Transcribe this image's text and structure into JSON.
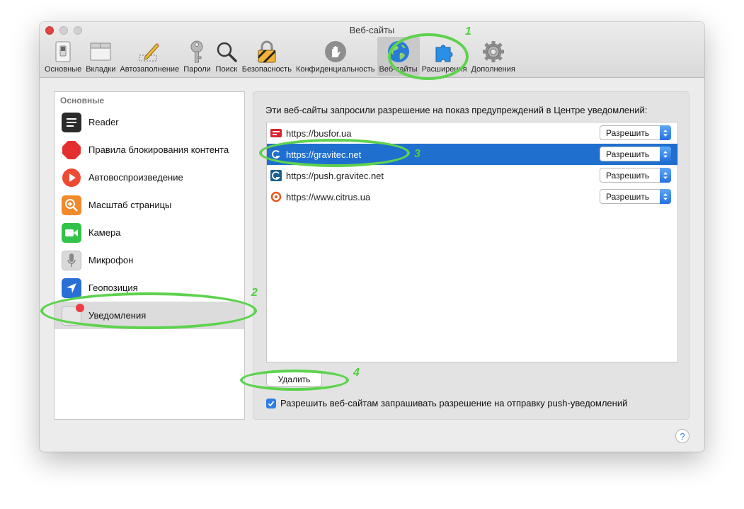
{
  "window": {
    "title": "Веб-сайты"
  },
  "toolbar": {
    "items": [
      {
        "label": "Основные",
        "icon": "general-switch-icon"
      },
      {
        "label": "Вкладки",
        "icon": "tabs-icon"
      },
      {
        "label": "Автозаполнение",
        "icon": "pencil-icon"
      },
      {
        "label": "Пароли",
        "icon": "key-icon"
      },
      {
        "label": "Поиск",
        "icon": "magnifier-icon"
      },
      {
        "label": "Безопасность",
        "icon": "padlock-icon"
      },
      {
        "label": "Конфиденциальность",
        "icon": "hand-icon"
      },
      {
        "label": "Веб-сайты",
        "icon": "globe-icon",
        "active": true
      },
      {
        "label": "Расширения",
        "icon": "puzzle-icon"
      },
      {
        "label": "Дополнения",
        "icon": "gear-icon"
      }
    ]
  },
  "sidebar": {
    "header": "Основные",
    "items": [
      {
        "label": "Reader",
        "icon": "reader-icon"
      },
      {
        "label": "Правила блокирования контента",
        "icon": "stop-icon"
      },
      {
        "label": "Автовоспроизведение",
        "icon": "play-icon"
      },
      {
        "label": "Масштаб страницы",
        "icon": "zoom-icon"
      },
      {
        "label": "Камера",
        "icon": "camera-icon"
      },
      {
        "label": "Микрофон",
        "icon": "microphone-icon"
      },
      {
        "label": "Геопозиция",
        "icon": "location-arrow-icon"
      },
      {
        "label": "Уведомления",
        "icon": "notifications-icon",
        "selected": true
      }
    ]
  },
  "content": {
    "description": "Эти веб-сайты запросили разрешение на показ предупреждений в Центре уведомлений:",
    "sites": [
      {
        "url": "https://busfor.ua",
        "permission": "Разрешить"
      },
      {
        "url": "https://gravitec.net",
        "permission": "Разрешить",
        "selected": true
      },
      {
        "url": "https://push.gravitec.net",
        "permission": "Разрешить"
      },
      {
        "url": "https://www.citrus.ua",
        "permission": "Разрешить"
      }
    ],
    "delete_label": "Удалить",
    "allow_push_label": "Разрешить веб-сайтам запрашивать разрешение на отправку push-уведомлений",
    "allow_push_checked": true,
    "help_label": "?"
  },
  "annotations": [
    "1",
    "2",
    "3",
    "4"
  ],
  "colors": {
    "selection": "#1f6fcf",
    "annotation": "#5ed24e",
    "accent": "#2f7de6"
  }
}
